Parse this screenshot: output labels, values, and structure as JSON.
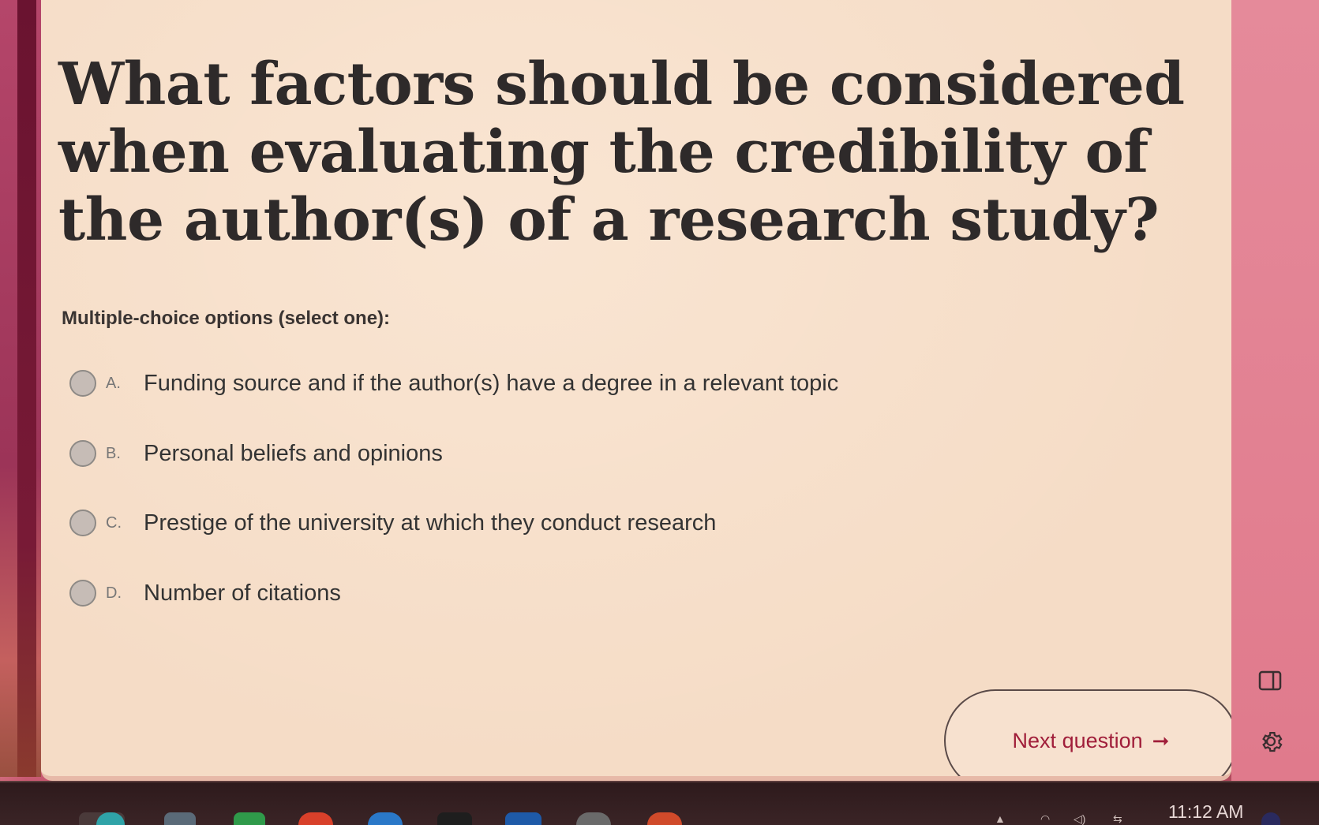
{
  "question": {
    "text": "What factors should be considered when evaluating the credibility of the author(s) of a research study?"
  },
  "instructions": "Multiple-choice options (select one):",
  "options": [
    {
      "letter": "A.",
      "text": "Funding source and if the author(s) have a degree in a relevant topic"
    },
    {
      "letter": "B.",
      "text": "Personal beliefs and opinions"
    },
    {
      "letter": "C.",
      "text": "Prestige of the university at which they conduct research"
    },
    {
      "letter": "D.",
      "text": "Number of citations"
    }
  ],
  "next_button": {
    "label": "Next question",
    "icon": "arrow-right-icon"
  },
  "sidebar_icons": [
    "panel-icon",
    "gear-icon"
  ],
  "taskbar": {
    "clock": "11:12 AM"
  },
  "colors": {
    "card_background": "#f5dcc6",
    "accent": "#a01e3a",
    "frame": "#c85a72"
  }
}
